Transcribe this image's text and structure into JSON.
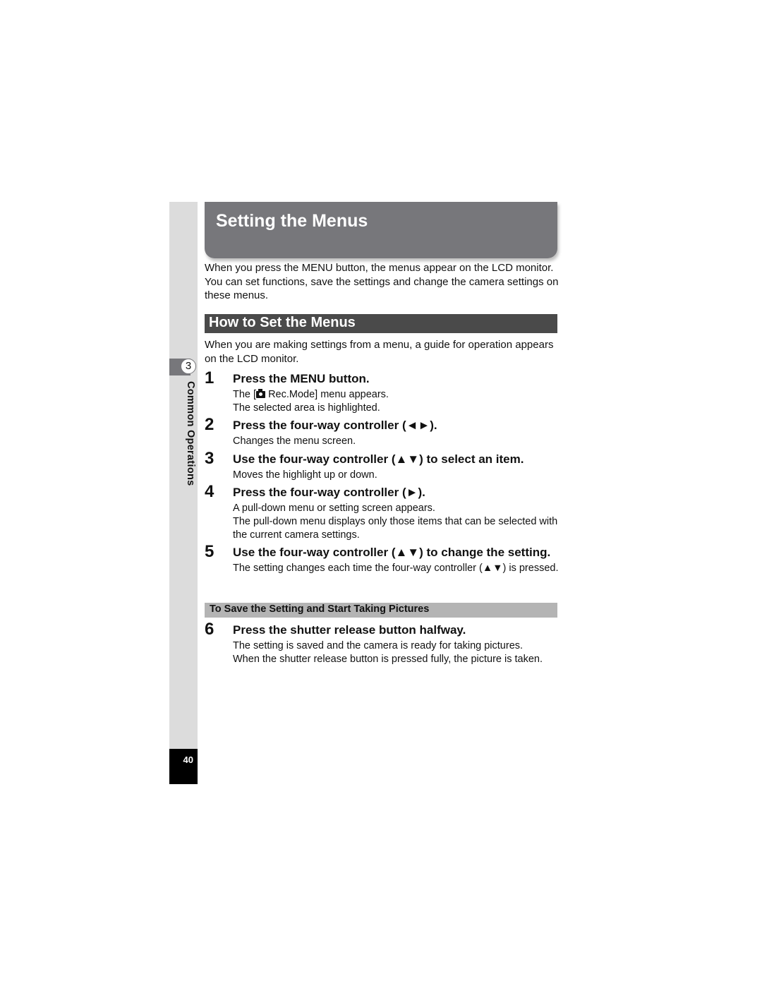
{
  "page": {
    "title": "Setting the Menus",
    "intro": "When you press the MENU button, the menus appear on the LCD monitor. You can set functions, save the settings and change the camera settings on these menus.",
    "section_title": "How to Set the Menus",
    "guide": "When you are making settings from a menu, a guide for operation appears on the LCD monitor.",
    "chapter_number": "3",
    "chapter_label": "Common Operations",
    "page_number": "40"
  },
  "steps": [
    {
      "num": "1",
      "head": "Press the MENU button.",
      "desc_pre": "The [",
      "icon": "camera-icon",
      "desc_post": " Rec.Mode] menu appears.",
      "desc2": "The selected area is highlighted."
    },
    {
      "num": "2",
      "head": "Press the four-way controller (◄►).",
      "desc": "Changes the menu screen."
    },
    {
      "num": "3",
      "head": "Use the four-way controller (▲▼) to select an item.",
      "desc": "Moves the highlight up or down."
    },
    {
      "num": "4",
      "head": "Press the four-way controller (►).",
      "desc": "A pull-down menu or setting screen appears.",
      "desc2": "The pull-down menu displays only those items that can be selected with the current camera settings."
    },
    {
      "num": "5",
      "head": "Use the four-way controller (▲▼) to change the setting.",
      "desc": "The setting changes each time the four-way controller (▲▼) is pressed."
    },
    {
      "num": "6",
      "head": "Press the shutter release button halfway.",
      "desc": "The setting is saved and the camera is ready for taking pictures.",
      "desc2": "When the shutter release button is pressed fully, the picture is taken."
    }
  ],
  "subsection_title": "To Save the Setting and Start Taking Pictures"
}
